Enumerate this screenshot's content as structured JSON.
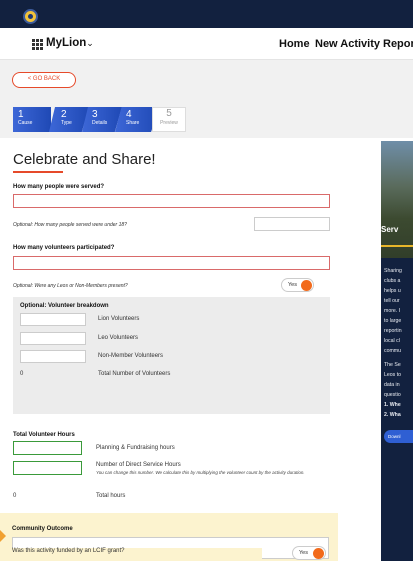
{
  "header": {
    "brand": "MyLion",
    "brand_chevron": "⌄",
    "nav": [
      "Home",
      "New Activity",
      "Report"
    ]
  },
  "back_label": "< GO BACK",
  "steps": [
    {
      "num": "1",
      "label": "Cause"
    },
    {
      "num": "2",
      "label": "Type"
    },
    {
      "num": "3",
      "label": "Details"
    },
    {
      "num": "4",
      "label": "Share"
    },
    {
      "num": "5",
      "label": "Preview"
    }
  ],
  "form": {
    "title": "Celebrate and Share!",
    "people_served_label": "How many people were served?",
    "people_served_value": "",
    "under18_label": "Optional: How many people served were under 18?",
    "under18_value": "",
    "volunteers_label": "How many volunteers participated?",
    "volunteers_value": "",
    "leos_label": "Optional: Were any Leos or Non-Members present?",
    "leos_toggle": "Yes",
    "breakdown_title": "Optional: Volunteer breakdown",
    "breakdown_rows": [
      "Lion Volunteers",
      "Leo Volunteers",
      "Non-Member Volunteers"
    ],
    "total_count": "0",
    "total_label": "Total Number of Volunteers",
    "hours_label": "Total Volunteer Hours",
    "planning_label": "Planning & Fundraising hours",
    "direct_label": "Number of Direct Service Hours",
    "direct_note": "You can change this number. We calculate this by multiplying the volunteer count by the activity duration.",
    "total_hours_value": "0",
    "total_hours_label": "Total hours",
    "community_label": "Community Outcome",
    "lcif_label": "Was this activity funded by an LCIF grant?",
    "lcif_toggle": "Yes"
  },
  "side": {
    "heading": "Serv",
    "paragraph_lines": [
      "Sharing",
      "clubs a",
      "helps u",
      "tell our",
      "more. I",
      "to large",
      "reportin",
      "local cl",
      "commu"
    ],
    "paragraph2_lines": [
      "The Se",
      "Leos to",
      "data in",
      "questio"
    ],
    "list_items": [
      "1. Whe",
      "2. Wha"
    ],
    "button": "Downl"
  },
  "colors": {
    "topbar": "#12213f",
    "accent": "#e64a2a",
    "step_blue": "#2a55c4",
    "toggle_knob": "#f26a1b",
    "community_bg": "#fcf3cf"
  }
}
